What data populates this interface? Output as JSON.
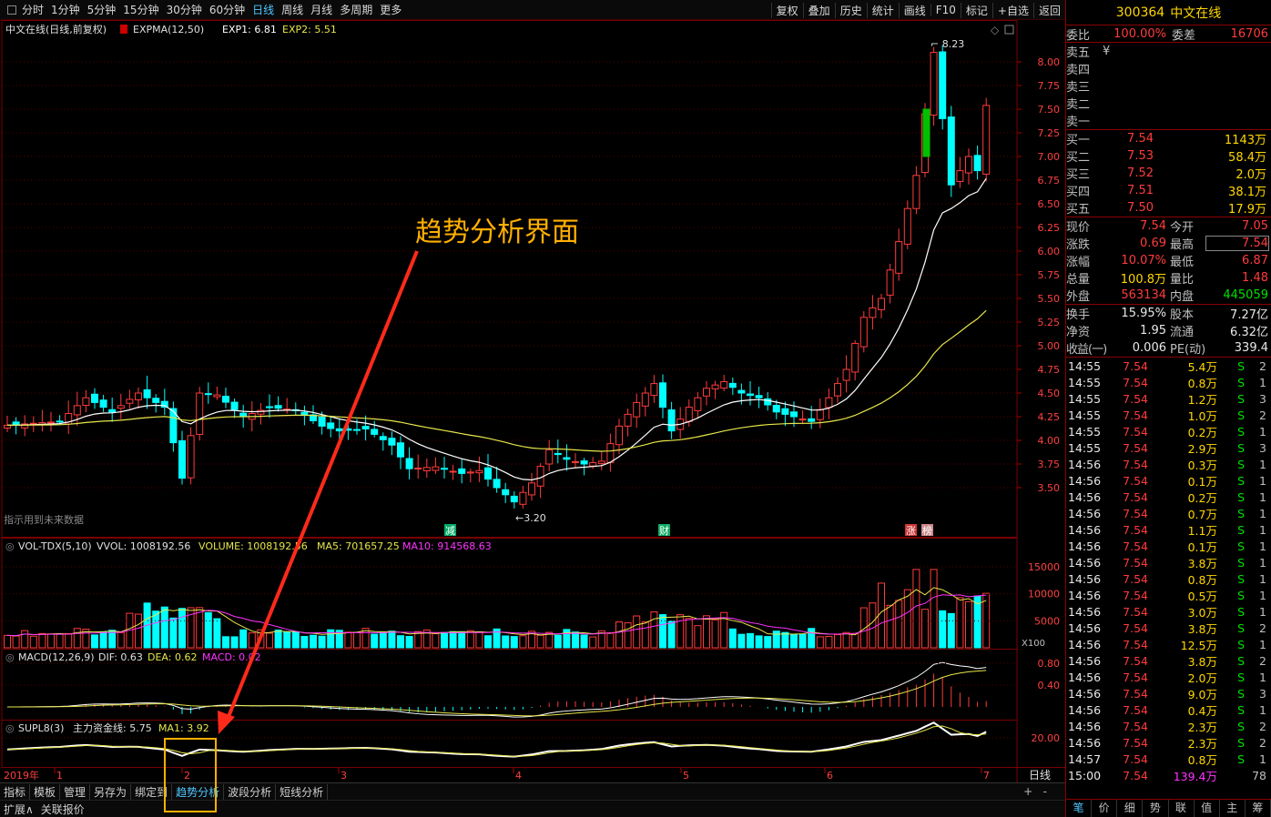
{
  "toolbar": {
    "periods": [
      "分时",
      "1分钟",
      "5分钟",
      "15分钟",
      "30分钟",
      "60分钟",
      "日线",
      "周线",
      "月线",
      "多周期",
      "更多"
    ],
    "active_period": "日线",
    "right": [
      "复权",
      "叠加",
      "历史",
      "统计",
      "画线",
      "F10",
      "标记",
      "+自选",
      "返回"
    ]
  },
  "chart": {
    "main_title": "中文在线(日线,前复权)",
    "expma_label": "EXPMA(12,50)",
    "exp1": "EXP1: 6.81",
    "exp2": "EXP2: 5.51",
    "high_label": "8.23",
    "low_label": "3.20",
    "hint": "指示用到未来数据",
    "price_ticks": [
      "8.00",
      "7.75",
      "7.50",
      "7.25",
      "7.00",
      "6.75",
      "6.50",
      "6.25",
      "6.00",
      "5.75",
      "5.50",
      "5.25",
      "5.00",
      "4.75",
      "4.50",
      "4.25",
      "4.00",
      "3.75",
      "3.50"
    ],
    "event_markers": [
      "减",
      "财",
      "涨",
      "榜"
    ],
    "vol_title": "VOL-TDX(5,10)",
    "vvol": "VVOL: 1008192.56",
    "volume": "VOLUME: 1008192.56",
    "ma5": "MA5: 701657.25",
    "ma10": "MA10: 914568.63",
    "vol_ticks": [
      "15000",
      "10000",
      "5000"
    ],
    "vol_unit": "X100",
    "macd_title": "MACD(12,26,9)",
    "dif": "DIF: 0.63",
    "dea": "DEA: 0.62",
    "macd": "MACD: 0.02",
    "macd_ticks": [
      "0.80",
      "0.40"
    ],
    "supl_title": "SUPL8(3)",
    "supl_line": "主力资金线: 5.75",
    "supl_ma": "MA1: 3.92",
    "supl_ticks": [
      "20.00"
    ],
    "year": "2019年",
    "months": [
      "1",
      "2",
      "3",
      "4",
      "5",
      "6",
      "7"
    ],
    "period_tag": "日线"
  },
  "bottom_tabs": [
    "指标",
    "模板",
    "管理",
    "另存为",
    "绑定到",
    "趋势分析",
    "波段分析",
    "短线分析"
  ],
  "active_bottom_tab": "趋势分析",
  "bottom2": [
    "扩展∧",
    "关联报价"
  ],
  "annotation": "趋势分析界面",
  "panel": {
    "code": "300364",
    "name": "中文在线",
    "weibi_label": "委比",
    "weibi": "100.00%",
    "weicha_label": "委差",
    "weicha": "16706",
    "sells": [
      {
        "label": "卖五",
        "price": "¥",
        "qty": ""
      },
      {
        "label": "卖四",
        "price": "",
        "qty": ""
      },
      {
        "label": "卖三",
        "price": "",
        "qty": ""
      },
      {
        "label": "卖二",
        "price": "",
        "qty": ""
      },
      {
        "label": "卖一",
        "price": "",
        "qty": ""
      }
    ],
    "buys": [
      {
        "label": "买一",
        "price": "7.54",
        "qty": "1143万"
      },
      {
        "label": "买二",
        "price": "7.53",
        "qty": "58.4万"
      },
      {
        "label": "买三",
        "price": "7.52",
        "qty": "2.0万"
      },
      {
        "label": "买四",
        "price": "7.51",
        "qty": "38.1万"
      },
      {
        "label": "买五",
        "price": "7.50",
        "qty": "17.9万"
      }
    ],
    "quote1": [
      {
        "k1": "现价",
        "v1": "7.54",
        "c1": "red",
        "k2": "今开",
        "v2": "7.05",
        "c2": "red"
      },
      {
        "k1": "涨跌",
        "v1": "0.69",
        "c1": "red",
        "k2": "最高",
        "v2": "7.54",
        "c2": "red"
      },
      {
        "k1": "涨幅",
        "v1": "10.07%",
        "c1": "red",
        "k2": "最低",
        "v2": "6.87",
        "c2": "red"
      },
      {
        "k1": "总量",
        "v1": "100.8万",
        "c1": "yellow",
        "k2": "量比",
        "v2": "1.48",
        "c2": "red"
      },
      {
        "k1": "外盘",
        "v1": "563134",
        "c1": "red",
        "k2": "内盘",
        "v2": "445059",
        "c2": "green"
      }
    ],
    "quote2": [
      {
        "k1": "换手",
        "v1": "15.95%",
        "c1": "white",
        "k2": "股本",
        "v2": "7.27亿",
        "c2": "white"
      },
      {
        "k1": "净资",
        "v1": "1.95",
        "c1": "white",
        "k2": "流通",
        "v2": "6.32亿",
        "c2": "white"
      },
      {
        "k1": "收益(一)",
        "v1": "0.006",
        "c1": "white",
        "k2": "PE(动)",
        "v2": "339.4",
        "c2": "white"
      }
    ],
    "ticks": [
      {
        "t": "14:55",
        "p": "7.54",
        "v": "5.4万",
        "bs": "S",
        "n": "2"
      },
      {
        "t": "14:55",
        "p": "7.54",
        "v": "0.8万",
        "bs": "S",
        "n": "1"
      },
      {
        "t": "14:55",
        "p": "7.54",
        "v": "1.2万",
        "bs": "S",
        "n": "3"
      },
      {
        "t": "14:55",
        "p": "7.54",
        "v": "1.0万",
        "bs": "S",
        "n": "2"
      },
      {
        "t": "14:55",
        "p": "7.54",
        "v": "0.2万",
        "bs": "S",
        "n": "1"
      },
      {
        "t": "14:55",
        "p": "7.54",
        "v": "2.9万",
        "bs": "S",
        "n": "3"
      },
      {
        "t": "14:56",
        "p": "7.54",
        "v": "0.3万",
        "bs": "S",
        "n": "1"
      },
      {
        "t": "14:56",
        "p": "7.54",
        "v": "0.1万",
        "bs": "S",
        "n": "1"
      },
      {
        "t": "14:56",
        "p": "7.54",
        "v": "0.2万",
        "bs": "S",
        "n": "1"
      },
      {
        "t": "14:56",
        "p": "7.54",
        "v": "0.7万",
        "bs": "S",
        "n": "1"
      },
      {
        "t": "14:56",
        "p": "7.54",
        "v": "1.1万",
        "bs": "S",
        "n": "1"
      },
      {
        "t": "14:56",
        "p": "7.54",
        "v": "0.1万",
        "bs": "S",
        "n": "1"
      },
      {
        "t": "14:56",
        "p": "7.54",
        "v": "3.8万",
        "bs": "S",
        "n": "1"
      },
      {
        "t": "14:56",
        "p": "7.54",
        "v": "0.8万",
        "bs": "S",
        "n": "1"
      },
      {
        "t": "14:56",
        "p": "7.54",
        "v": "0.5万",
        "bs": "S",
        "n": "1"
      },
      {
        "t": "14:56",
        "p": "7.54",
        "v": "3.0万",
        "bs": "S",
        "n": "1"
      },
      {
        "t": "14:56",
        "p": "7.54",
        "v": "3.8万",
        "bs": "S",
        "n": "2"
      },
      {
        "t": "14:56",
        "p": "7.54",
        "v": "12.5万",
        "bs": "S",
        "n": "1"
      },
      {
        "t": "14:56",
        "p": "7.54",
        "v": "3.8万",
        "bs": "S",
        "n": "2"
      },
      {
        "t": "14:56",
        "p": "7.54",
        "v": "2.0万",
        "bs": "S",
        "n": "1"
      },
      {
        "t": "14:56",
        "p": "7.54",
        "v": "9.0万",
        "bs": "S",
        "n": "3"
      },
      {
        "t": "14:56",
        "p": "7.54",
        "v": "0.4万",
        "bs": "S",
        "n": "1"
      },
      {
        "t": "14:56",
        "p": "7.54",
        "v": "2.3万",
        "bs": "S",
        "n": "2"
      },
      {
        "t": "14:56",
        "p": "7.54",
        "v": "2.3万",
        "bs": "S",
        "n": "2"
      },
      {
        "t": "14:57",
        "p": "7.54",
        "v": "0.8万",
        "bs": "S",
        "n": "1"
      },
      {
        "t": "15:00",
        "p": "7.54",
        "v": "139.4万",
        "bs": "",
        "n": "78"
      }
    ],
    "tabs": [
      "笔",
      "价",
      "细",
      "势",
      "联",
      "值",
      "主",
      "筹"
    ],
    "active_tab": "笔"
  },
  "colors": {
    "up": "#ff3b3b",
    "down": "#00ffff",
    "grid": "#5a0000",
    "exp1": "#ffffff",
    "exp2": "#e6e64a",
    "ma10": "#ff33ff",
    "accent": "#4fc8ff",
    "annotation": "#ffb000"
  }
}
